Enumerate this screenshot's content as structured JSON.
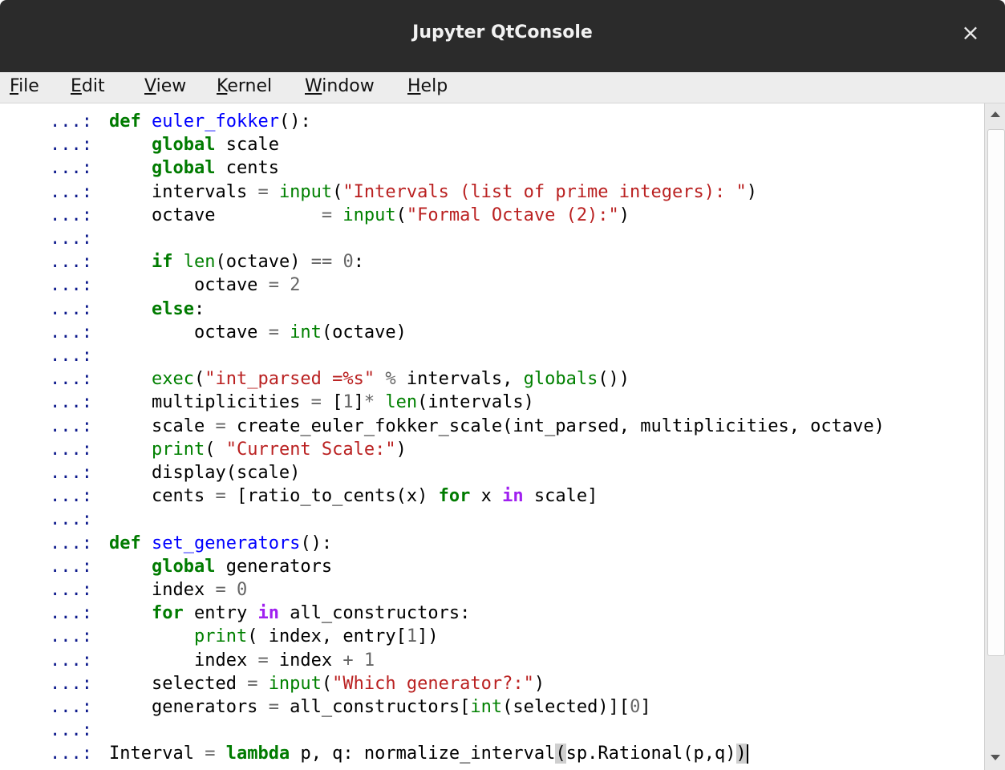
{
  "window": {
    "title": "Jupyter QtConsole",
    "close_symbol": "×"
  },
  "menu": [
    {
      "first": "F",
      "rest": "ile"
    },
    {
      "first": "E",
      "rest": "dit"
    },
    {
      "first": "V",
      "rest": "iew"
    },
    {
      "first": "K",
      "rest": "ernel"
    },
    {
      "first": "W",
      "rest": "indow"
    },
    {
      "first": "H",
      "rest": "elp"
    }
  ],
  "prompts": {
    "def": "...:",
    "cont": "...:"
  },
  "code_lines": [
    "def euler_fokker():",
    "    global scale",
    "    global cents",
    "    intervals = input(\"Intervals (list of prime integers): \")",
    "    octave          = input(\"Formal Octave (2):\")",
    "",
    "    if len(octave) == 0:",
    "        octave = 2",
    "    else:",
    "        octave = int(octave)",
    "",
    "    exec(\"int_parsed =%s\" % intervals, globals())",
    "    multiplicities = [1]* len(intervals)",
    "    scale = create_euler_fokker_scale(int_parsed, multiplicities, octave)",
    "    print( \"Current Scale:\")",
    "    display(scale)",
    "    cents = [ratio_to_cents(x) for x in scale]",
    "",
    "def set_generators():",
    "    global generators",
    "    index = 0",
    "    for entry in all_constructors:",
    "        print( index, entry[1])",
    "        index = index + 1",
    "    selected = input(\"Which generator?:\")",
    "    generators = all_constructors[int(selected)][0]",
    "",
    "Interval = lambda p, q: normalize_interval(sp.Rational(p,q))"
  ]
}
